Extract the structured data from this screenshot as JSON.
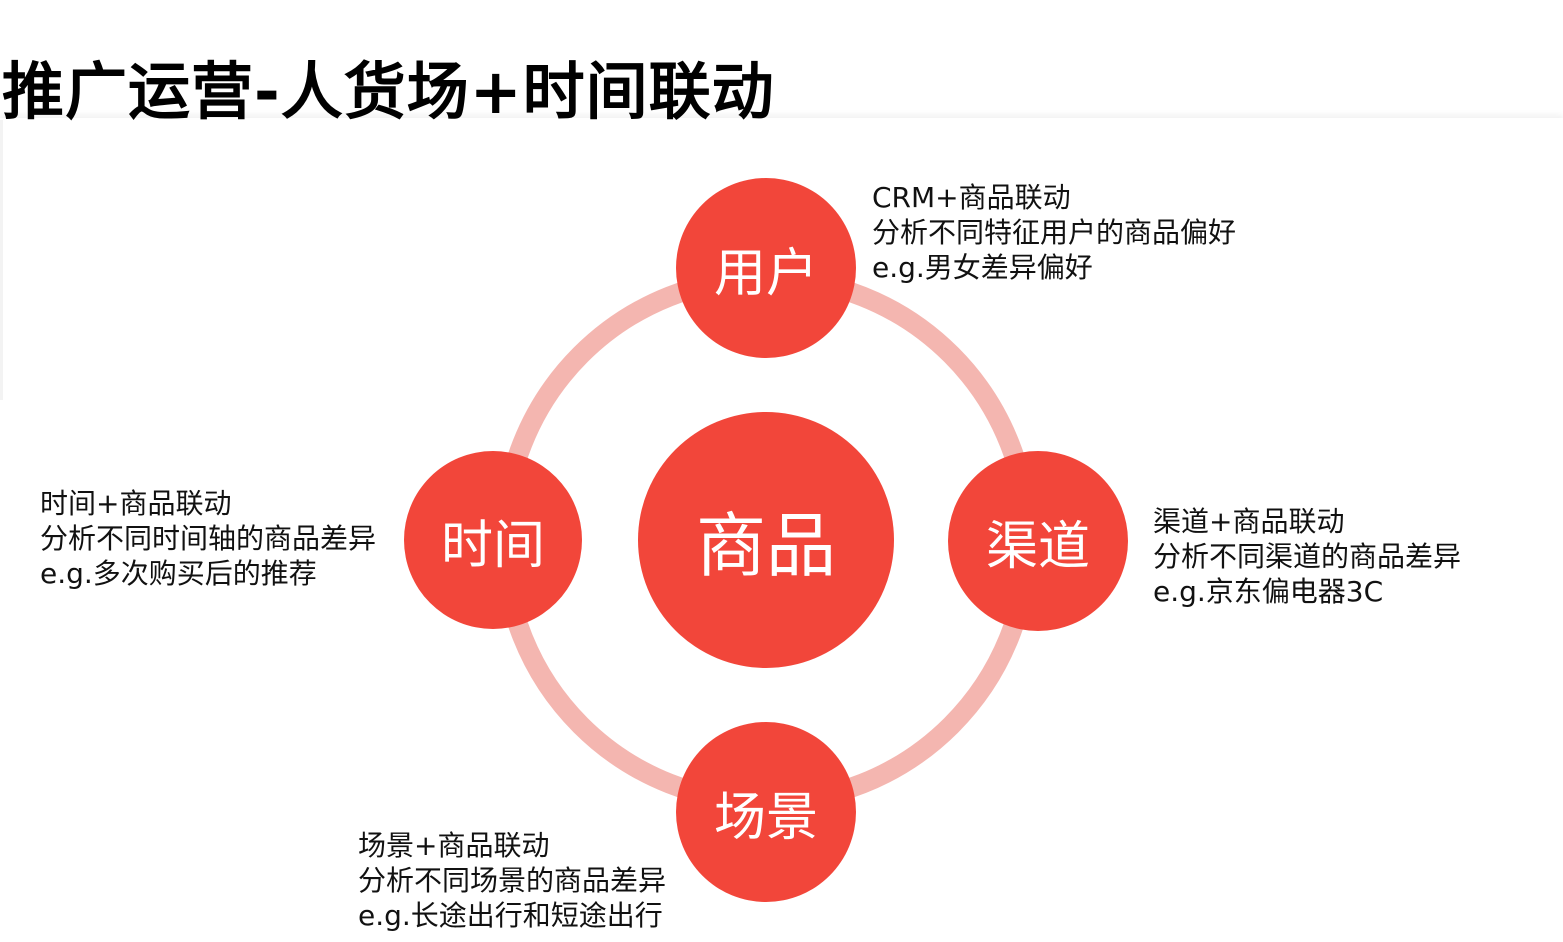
{
  "title": "推广运营-人货场+时间联动",
  "colors": {
    "node_fill": "#f2463a",
    "ring": "#f4b6b0",
    "node_text": "#ffffff",
    "text": "#111111"
  },
  "center_node": {
    "label": "商品"
  },
  "nodes": {
    "user": {
      "label": "用户"
    },
    "time": {
      "label": "时间"
    },
    "channel": {
      "label": "渠道"
    },
    "scene": {
      "label": "场景"
    }
  },
  "descriptions": {
    "user": {
      "line1": "CRM+商品联动",
      "line2": "分析不同特征用户的商品偏好",
      "line3": "e.g.男女差异偏好"
    },
    "time": {
      "line1": "时间+商品联动",
      "line2": "分析不同时间轴的商品差异",
      "line3": "e.g.多次购买后的推荐"
    },
    "channel": {
      "line1": "渠道+商品联动",
      "line2": "分析不同渠道的商品差异",
      "line3": "e.g.京东偏电器3C"
    },
    "scene": {
      "line1": "场景+商品联动",
      "line2": "分析不同场景的商品差异",
      "line3": "e.g.长途出行和短途出行"
    }
  }
}
